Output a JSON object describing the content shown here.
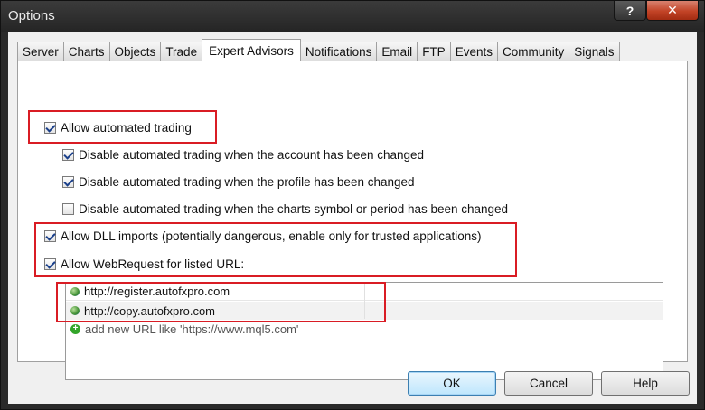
{
  "window": {
    "title": "Options",
    "help_glyph": "?",
    "close_glyph": "✕"
  },
  "tabs": [
    {
      "label": "Server"
    },
    {
      "label": "Charts"
    },
    {
      "label": "Objects"
    },
    {
      "label": "Trade"
    },
    {
      "label": "Expert Advisors",
      "active": true
    },
    {
      "label": "Notifications"
    },
    {
      "label": "Email"
    },
    {
      "label": "FTP"
    },
    {
      "label": "Events"
    },
    {
      "label": "Community"
    },
    {
      "label": "Signals"
    }
  ],
  "options": {
    "allow_automated_trading": {
      "label": "Allow automated trading",
      "checked": true
    },
    "disable_on_account_change": {
      "label": "Disable automated trading when the account has been changed",
      "checked": true
    },
    "disable_on_profile_change": {
      "label": "Disable automated trading when the profile has been changed",
      "checked": true
    },
    "disable_on_symbol_change": {
      "label": "Disable automated trading when the charts symbol or period has been changed",
      "checked": false
    },
    "allow_dll_imports": {
      "label": "Allow DLL imports (potentially dangerous, enable only for trusted applications)",
      "checked": true
    },
    "allow_webrequest": {
      "label": "Allow WebRequest for listed URL:",
      "checked": true
    }
  },
  "url_list": {
    "items": [
      "http://register.autofxpro.com",
      "http://copy.autofxpro.com"
    ],
    "add_text": "add new URL like 'https://www.mql5.com'"
  },
  "buttons": {
    "ok": "OK",
    "cancel": "Cancel",
    "help": "Help"
  },
  "colors": {
    "highlight": "#d91c24",
    "close_button": "#c24326",
    "default_button_border": "#3c7fb1"
  }
}
